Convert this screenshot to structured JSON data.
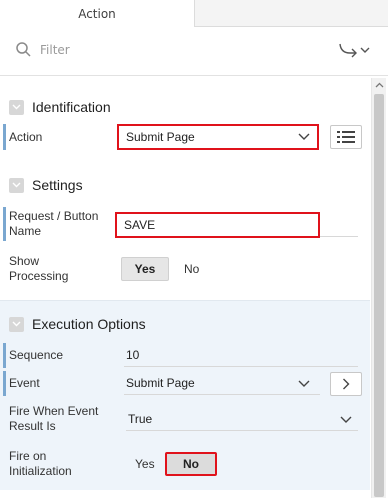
{
  "tabs": {
    "active": "Action"
  },
  "filter": {
    "placeholder": "Filter"
  },
  "sections": {
    "identification": {
      "title": "Identification",
      "action_label": "Action",
      "action_value": "Submit Page"
    },
    "settings": {
      "title": "Settings",
      "request_label_line1": "Request / Button",
      "request_label_line2": "Name",
      "request_value": "SAVE",
      "show_processing_label_line1": "Show",
      "show_processing_label_line2": "Processing",
      "yes_label": "Yes",
      "no_label": "No",
      "selected": "Yes"
    },
    "execution": {
      "title": "Execution Options",
      "sequence_label": "Sequence",
      "sequence_value": "10",
      "event_label": "Event",
      "event_value": "Submit Page",
      "fire_when_label_line1": "Fire When Event",
      "fire_when_label_line2": "Result Is",
      "fire_when_value": "True",
      "fire_init_label_line1": "Fire on",
      "fire_init_label_line2": "Initialization",
      "yes_label": "Yes",
      "no_label": "No",
      "selected": "No"
    }
  },
  "colors": {
    "highlight": "#e0121b",
    "required_bar": "#7aa7d0",
    "exec_bg": "#eef4fa"
  }
}
